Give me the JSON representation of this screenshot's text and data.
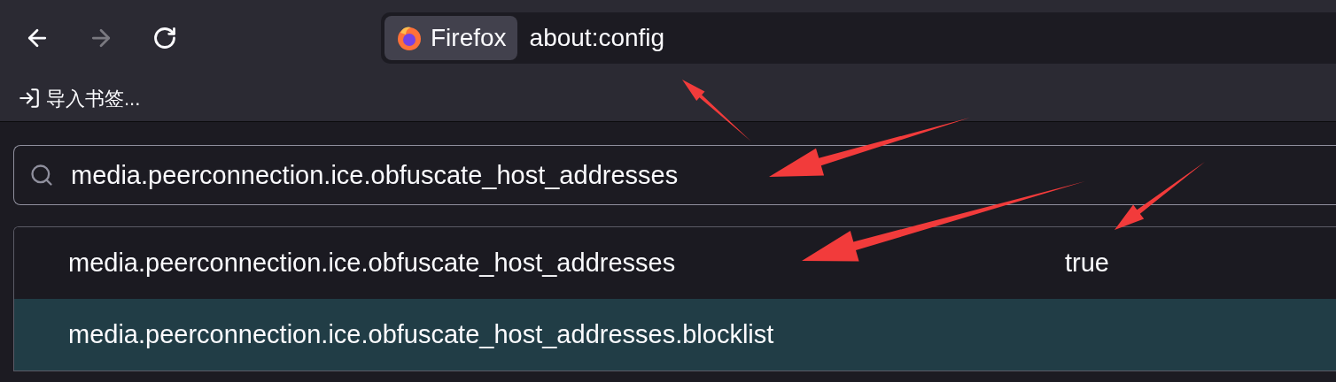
{
  "toolbar": {
    "identity_label": "Firefox",
    "url": "about:config"
  },
  "bookmarks": [
    {
      "label": "导入书签..."
    }
  ],
  "search": {
    "value": "media.peerconnection.ice.obfuscate_host_addresses"
  },
  "prefs": [
    {
      "name": "media.peerconnection.ice.obfuscate_host_addresses",
      "value": "true",
      "selected": false
    },
    {
      "name": "media.peerconnection.ice.obfuscate_host_addresses.blocklist",
      "selected": true
    }
  ]
}
